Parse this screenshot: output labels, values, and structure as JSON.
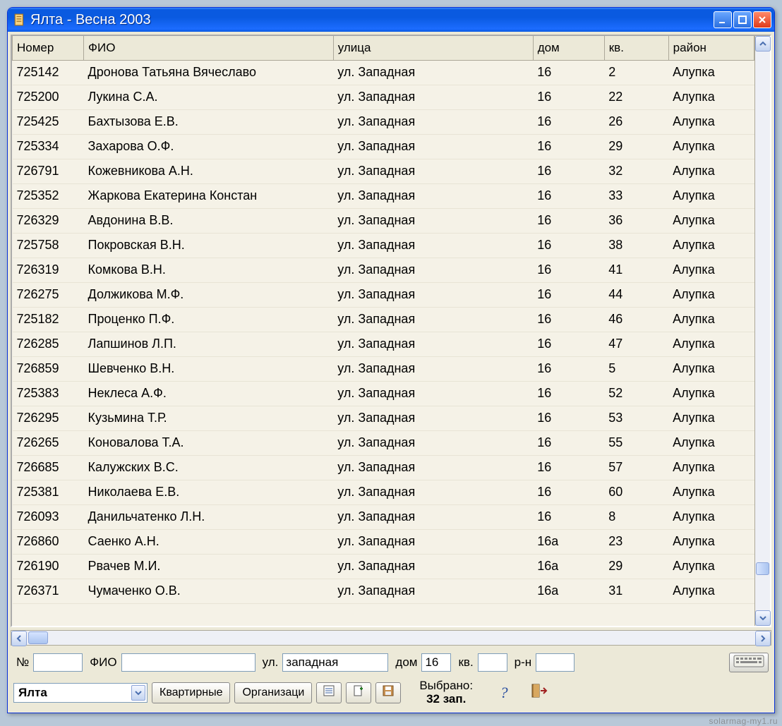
{
  "window": {
    "title": "Ялта  - Весна 2003"
  },
  "table": {
    "headers": {
      "number": "Номер",
      "fio": "ФИО",
      "street": "улица",
      "house": "дом",
      "apt": "кв.",
      "region": "район"
    },
    "rows": [
      {
        "num": "725142",
        "fio": "Дронова Татьяна Вячеславо",
        "street": "ул. Западная",
        "house": "16",
        "apt": "2",
        "region": "Алупка"
      },
      {
        "num": "725200",
        "fio": "Лукина С.А.",
        "street": "ул. Западная",
        "house": "16",
        "apt": "22",
        "region": "Алупка"
      },
      {
        "num": "725425",
        "fio": "Бахтызова Е.В.",
        "street": "ул. Западная",
        "house": "16",
        "apt": "26",
        "region": "Алупка"
      },
      {
        "num": "725334",
        "fio": "Захарова О.Ф.",
        "street": "ул. Западная",
        "house": "16",
        "apt": "29",
        "region": "Алупка"
      },
      {
        "num": "726791",
        "fio": "Кожевникова А.Н.",
        "street": "ул. Западная",
        "house": "16",
        "apt": "32",
        "region": "Алупка"
      },
      {
        "num": "725352",
        "fio": "Жаркова Екатерина Констан",
        "street": "ул. Западная",
        "house": "16",
        "apt": "33",
        "region": "Алупка"
      },
      {
        "num": "726329",
        "fio": "Авдонина В.В.",
        "street": "ул. Западная",
        "house": "16",
        "apt": "36",
        "region": "Алупка"
      },
      {
        "num": "725758",
        "fio": "Покровская В.Н.",
        "street": "ул. Западная",
        "house": "16",
        "apt": "38",
        "region": "Алупка"
      },
      {
        "num": "726319",
        "fio": "Комкова В.Н.",
        "street": "ул. Западная",
        "house": "16",
        "apt": "41",
        "region": "Алупка"
      },
      {
        "num": "726275",
        "fio": "Должикова М.Ф.",
        "street": "ул. Западная",
        "house": "16",
        "apt": "44",
        "region": "Алупка"
      },
      {
        "num": "725182",
        "fio": "Проценко П.Ф.",
        "street": "ул. Западная",
        "house": "16",
        "apt": "46",
        "region": "Алупка"
      },
      {
        "num": "726285",
        "fio": "Лапшинов Л.П.",
        "street": "ул. Западная",
        "house": "16",
        "apt": "47",
        "region": "Алупка"
      },
      {
        "num": "726859",
        "fio": "Шевченко В.Н.",
        "street": "ул. Западная",
        "house": "16",
        "apt": "5",
        "region": "Алупка"
      },
      {
        "num": "725383",
        "fio": "Неклеса А.Ф.",
        "street": "ул. Западная",
        "house": "16",
        "apt": "52",
        "region": "Алупка"
      },
      {
        "num": "726295",
        "fio": "Кузьмина Т.Р.",
        "street": "ул. Западная",
        "house": "16",
        "apt": "53",
        "region": "Алупка"
      },
      {
        "num": "726265",
        "fio": "Коновалова Т.А.",
        "street": "ул. Западная",
        "house": "16",
        "apt": "55",
        "region": "Алупка"
      },
      {
        "num": "726685",
        "fio": "Калужских В.С.",
        "street": "ул. Западная",
        "house": "16",
        "apt": "57",
        "region": "Алупка"
      },
      {
        "num": "725381",
        "fio": "Николаева Е.В.",
        "street": "ул. Западная",
        "house": "16",
        "apt": "60",
        "region": "Алупка"
      },
      {
        "num": "726093",
        "fio": "Данильчатенко Л.Н.",
        "street": "ул. Западная",
        "house": "16",
        "apt": "8",
        "region": "Алупка"
      },
      {
        "num": "726860",
        "fio": "Саенко А.Н.",
        "street": "ул. Западная",
        "house": "16а",
        "apt": "23",
        "region": "Алупка"
      },
      {
        "num": "726190",
        "fio": "Рвачев М.И.",
        "street": "ул. Западная",
        "house": "16а",
        "apt": "29",
        "region": "Алупка"
      },
      {
        "num": "726371",
        "fio": "Чумаченко О.В.",
        "street": "ул. Западная",
        "house": "16а",
        "apt": "31",
        "region": "Алупка"
      }
    ]
  },
  "filter": {
    "num_label": "№",
    "num_value": "",
    "fio_label": "ФИО",
    "fio_value": "",
    "street_label": "ул.",
    "street_value": "западная",
    "house_label": "дом",
    "house_value": "16",
    "apt_label": "кв.",
    "apt_value": "",
    "region_label": "р-н",
    "region_value": ""
  },
  "toolbar": {
    "city_selected": "Ялта",
    "apartments_btn": "Квартирные",
    "orgs_btn": "Организаци",
    "selected_label": "Выбрано:",
    "selected_count": "32 зап."
  },
  "watermark": "solarmag-my1.ru"
}
